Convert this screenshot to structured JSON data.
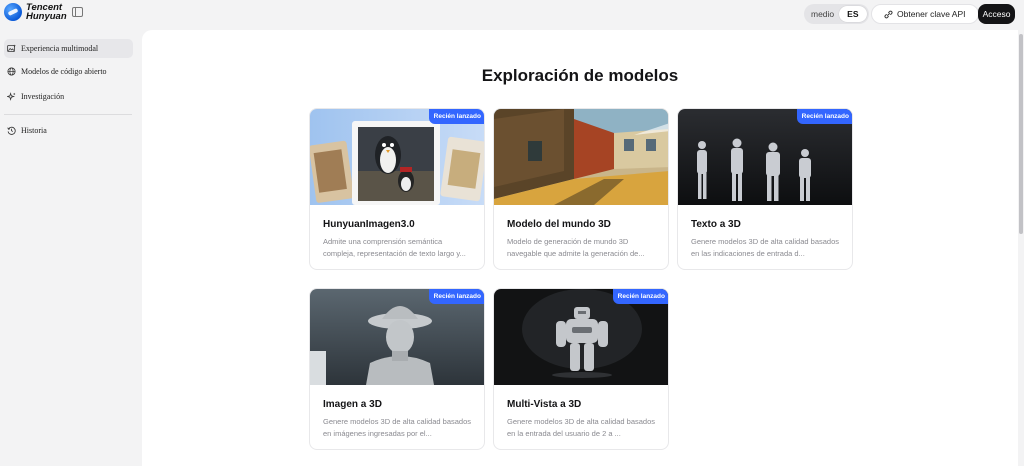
{
  "header": {
    "logo_line1": "Tencent",
    "logo_line2": "Hunyuan",
    "lang_option": "medio",
    "lang_active": "ES",
    "api_button": "Obtener clave API",
    "login_button": "Acceso"
  },
  "sidebar": {
    "items": [
      {
        "label": "Experiencia multimodal",
        "icon": "image-sparkle-icon",
        "active": true
      },
      {
        "label": "Modelos de código abierto",
        "icon": "globe-icon",
        "active": false
      },
      {
        "label": "Investigación",
        "icon": "sparkle-icon",
        "active": false
      },
      {
        "label": "Historia",
        "icon": "history-icon",
        "active": false
      }
    ]
  },
  "main": {
    "title": "Exploración de modelos",
    "cards": [
      {
        "title": "HunyuanImagen3.0",
        "desc": "Admite una comprensión semántica compleja, representación de texto largo y...",
        "badge": "Recién lanzado"
      },
      {
        "title": "Modelo del mundo 3D",
        "desc": "Modelo de generación de mundo 3D navegable que admite la generación de...",
        "badge": ""
      },
      {
        "title": "Texto a 3D",
        "desc": "Genere modelos 3D de alta calidad basados en las indicaciones de entrada d...",
        "badge": "Recién lanzado"
      },
      {
        "title": "Imagen a 3D",
        "desc": "Genere modelos 3D de alta calidad basados en imágenes ingresadas por el...",
        "badge": "Recién lanzado"
      },
      {
        "title": "Multi-Vista a 3D",
        "desc": "Genere modelos 3D de alta calidad basados en la entrada del usuario de 2 a ...",
        "badge": "Recién lanzado"
      }
    ]
  },
  "colors": {
    "accent": "#3366ff",
    "dark_button": "#141416",
    "background": "#f3f3f4"
  }
}
